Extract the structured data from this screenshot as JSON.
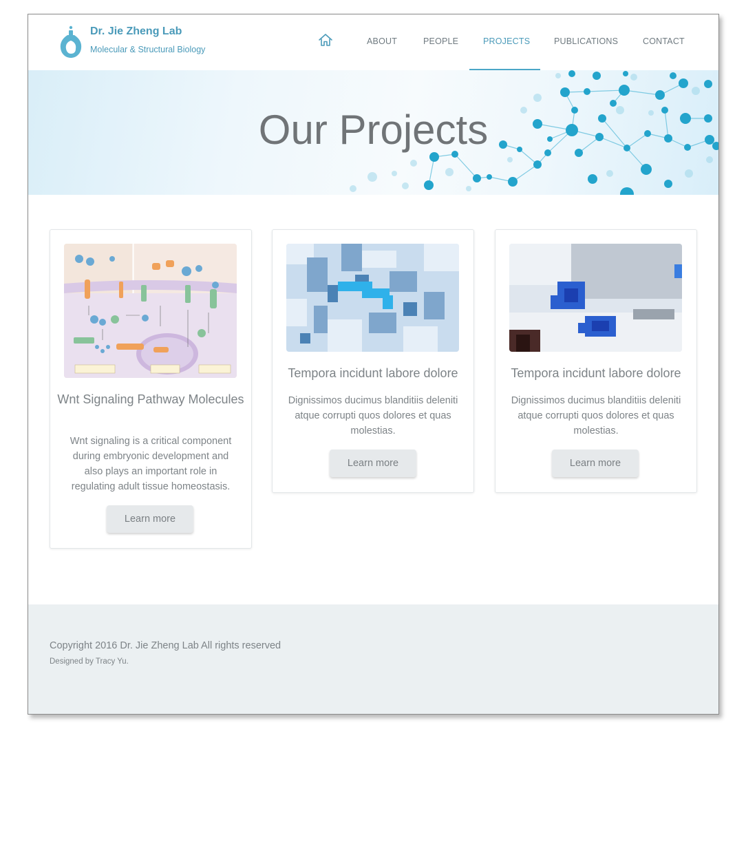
{
  "brand": {
    "title": "Dr. Jie Zheng Lab",
    "subtitle": "Molecular & Structural Biology"
  },
  "nav": {
    "items": [
      {
        "label": "ABOUT"
      },
      {
        "label": "PEOPLE"
      },
      {
        "label": "PROJECTS",
        "active": true
      },
      {
        "label": "PUBLICATIONS"
      },
      {
        "label": "CONTACT"
      }
    ]
  },
  "hero": {
    "title": "Our Projects"
  },
  "cards": [
    {
      "title": "Wnt Signaling Pathway Molecules",
      "text": "Wnt signaling is a critical component during embryonic development and also plays an important role in regulating adult tissue homeostasis.",
      "button": "Learn more"
    },
    {
      "title": "Tempora incidunt labore dolore",
      "text": "Dignissimos ducimus blanditiis deleniti atque corrupti quos dolores et quas molestias.",
      "button": "Learn more"
    },
    {
      "title": "Tempora incidunt labore dolore",
      "text": "Dignissimos ducimus blanditiis deleniti atque corrupti quos dolores et quas molestias.",
      "button": "Learn more"
    }
  ],
  "footer": {
    "copyright": "Copyright 2016 Dr. Jie Zheng Lab All rights reserved",
    "designed": "Designed by Tracy Yu."
  },
  "colors": {
    "accent": "#4a9ab9",
    "text": "#7d8387",
    "footer_bg": "#ebf0f2"
  },
  "icons": [
    "flask-logo-icon",
    "home-icon"
  ]
}
